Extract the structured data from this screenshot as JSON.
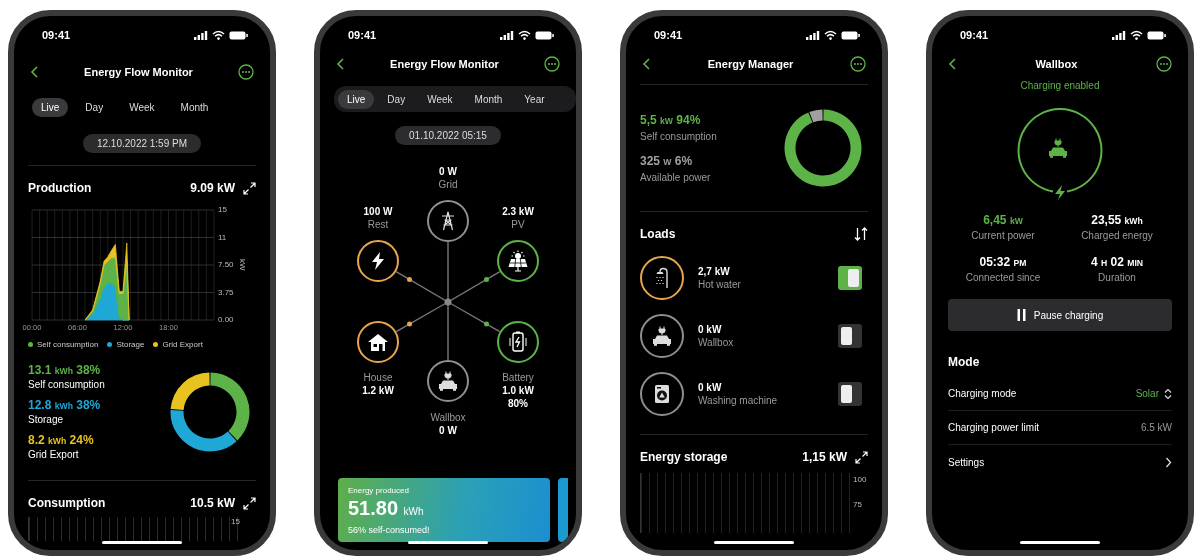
{
  "phones": [
    {
      "kind": "production",
      "time": "09:41",
      "title": "Energy Flow Monitor",
      "tabs": [
        {
          "label": "Live",
          "selected": true
        },
        {
          "label": "Day",
          "selected": false
        },
        {
          "label": "Week",
          "selected": false
        },
        {
          "label": "Month",
          "selected": false
        }
      ],
      "timestamp": "12.10.2022  1:59 PM",
      "production": {
        "title": "Production",
        "value": "9.09",
        "unit": "kW",
        "chart_data": {
          "type": "area",
          "stacked": true,
          "grid": true,
          "ylabel": "kW",
          "xlim": [
            0,
            24
          ],
          "ylim": [
            0,
            15
          ],
          "x": [
            7,
            8,
            9,
            9.5,
            10,
            10.5,
            11,
            11.5,
            12,
            12.5,
            12.8
          ],
          "xticks": [
            {
              "value": 0,
              "label": "00:00"
            },
            {
              "value": 6,
              "label": "06:00"
            },
            {
              "value": 12,
              "label": "12:00"
            },
            {
              "value": 18,
              "label": "18:00"
            }
          ],
          "yticks": [
            {
              "value": 0,
              "label": "0.00"
            },
            {
              "value": 3.75,
              "label": "3.75"
            },
            {
              "value": 7.5,
              "label": "7.50"
            },
            {
              "value": 11.25,
              "label": "11"
            },
            {
              "value": 15,
              "label": "15"
            }
          ],
          "series": [
            {
              "name": "Storage",
              "color": "#1fa7d6",
              "values": [
                0,
                0.8,
                3,
                4.5,
                5,
                5,
                4.5,
                0.3,
                0,
                0,
                0
              ]
            },
            {
              "name": "Self consumption",
              "color": "#5db348",
              "values": [
                0,
                0.4,
                2,
                3,
                3,
                3.5,
                4,
                3.3,
                3.6,
                8,
                0
              ]
            },
            {
              "name": "Grid Export",
              "color": "#e8c21f",
              "values": [
                0,
                0.2,
                0.3,
                0.5,
                0.6,
                1,
                1.8,
                0.3,
                0.3,
                2.5,
                0
              ]
            }
          ]
        },
        "stats": [
          {
            "parts": [
              "13.1",
              "kWh",
              "38%"
            ],
            "color": "#5db348"
          },
          {
            "parts": [
              "12.8",
              "kWh",
              "38%"
            ],
            "color": "#1fa7d6"
          },
          {
            "parts": [
              "8.2",
              "kWh",
              "24%"
            ],
            "color": "#e8c21f"
          }
        ],
        "donut": {
          "chart_data": {
            "type": "donut",
            "categories": [
              "Self consumption",
              "Storage",
              "Grid Export"
            ],
            "values": [
              38,
              38,
              24
            ]
          }
        }
      },
      "consumption": {
        "title": "Consumption",
        "value": "10.5",
        "unit": "kW",
        "tick": "15"
      }
    },
    {
      "kind": "flow",
      "time": "09:41",
      "title": "Energy Flow Monitor",
      "tabs": [
        {
          "label": "Live",
          "selected": true
        },
        {
          "label": "Day",
          "selected": false
        },
        {
          "label": "Week",
          "selected": false
        },
        {
          "label": "Month",
          "selected": false
        },
        {
          "label": "Year",
          "selected": false
        }
      ],
      "timestamp": "01.10.2022 05:15",
      "nodes": [
        {
          "label": "Grid",
          "value": "0 W",
          "color": "#8e8e93",
          "flow": false
        },
        {
          "label": "Rest",
          "value": "100 W",
          "color": "#e8a64a",
          "flow": true
        },
        {
          "label": "PV",
          "value": "2.3 kW",
          "color": "#5db348",
          "flow": true
        },
        {
          "label": "House",
          "value": "1.2 kW",
          "color": "#e8a64a",
          "flow": true
        },
        {
          "label": "Battery",
          "value": "1.0 kW",
          "extra": "80%",
          "color": "#5db348",
          "flow": true
        },
        {
          "label": "Wallbox",
          "value": "0 W",
          "color": "#8e8e93",
          "flow": false
        }
      ],
      "card": {
        "title": "Energy produced",
        "value": "51.80",
        "unit": "kWh",
        "note": "56% self-consumed!"
      }
    },
    {
      "kind": "manager",
      "time": "09:41",
      "title": "Energy Manager",
      "summary": [
        {
          "parts": [
            "5,5",
            "kW",
            "94%"
          ],
          "color": "#5db348"
        },
        {
          "parts": [
            "325",
            "W",
            "6%"
          ],
          "color": "#a0a0a0"
        }
      ],
      "donut": {
        "chart_data": {
          "type": "donut",
          "categories": [
            "Self consumption",
            "Available power"
          ],
          "values": [
            94,
            6
          ]
        }
      },
      "loads_title": "Loads",
      "loads": [
        {
          "value": "2,7 kW",
          "label": "Hot water",
          "on": true
        },
        {
          "value": "0 kW",
          "label": "Wallbox",
          "on": false
        },
        {
          "value": "0 kW",
          "label": "Washing machine",
          "on": false
        }
      ],
      "storage": {
        "title": "Energy storage",
        "value": "1,15",
        "unit": "kW",
        "ticks": [
          "100",
          "75"
        ]
      }
    },
    {
      "kind": "wallbox",
      "time": "09:41",
      "title": "Wallbox",
      "status": "Charging enabled",
      "stats": [
        {
          "parts": [
            "6,45",
            "kW"
          ],
          "label": "Current power",
          "highlight": true
        },
        {
          "parts": [
            "23,55",
            "kWh"
          ],
          "label": "Charged energy",
          "highlight": false
        },
        {
          "parts": [
            "05:32",
            "PM"
          ],
          "label": "Connected since",
          "highlight": false
        },
        {
          "parts": [
            "4",
            "H",
            "02",
            "MIN"
          ],
          "label": "Duration",
          "highlight": false
        }
      ],
      "button": "Pause charging",
      "mode_title": "Mode",
      "settings": [
        {
          "kind": "select",
          "label": "Charging mode",
          "value": "Solar"
        },
        {
          "kind": "value",
          "label": "Charging power limit",
          "value": "6.5 kW"
        },
        {
          "kind": "link",
          "label": "Settings"
        }
      ]
    }
  ]
}
